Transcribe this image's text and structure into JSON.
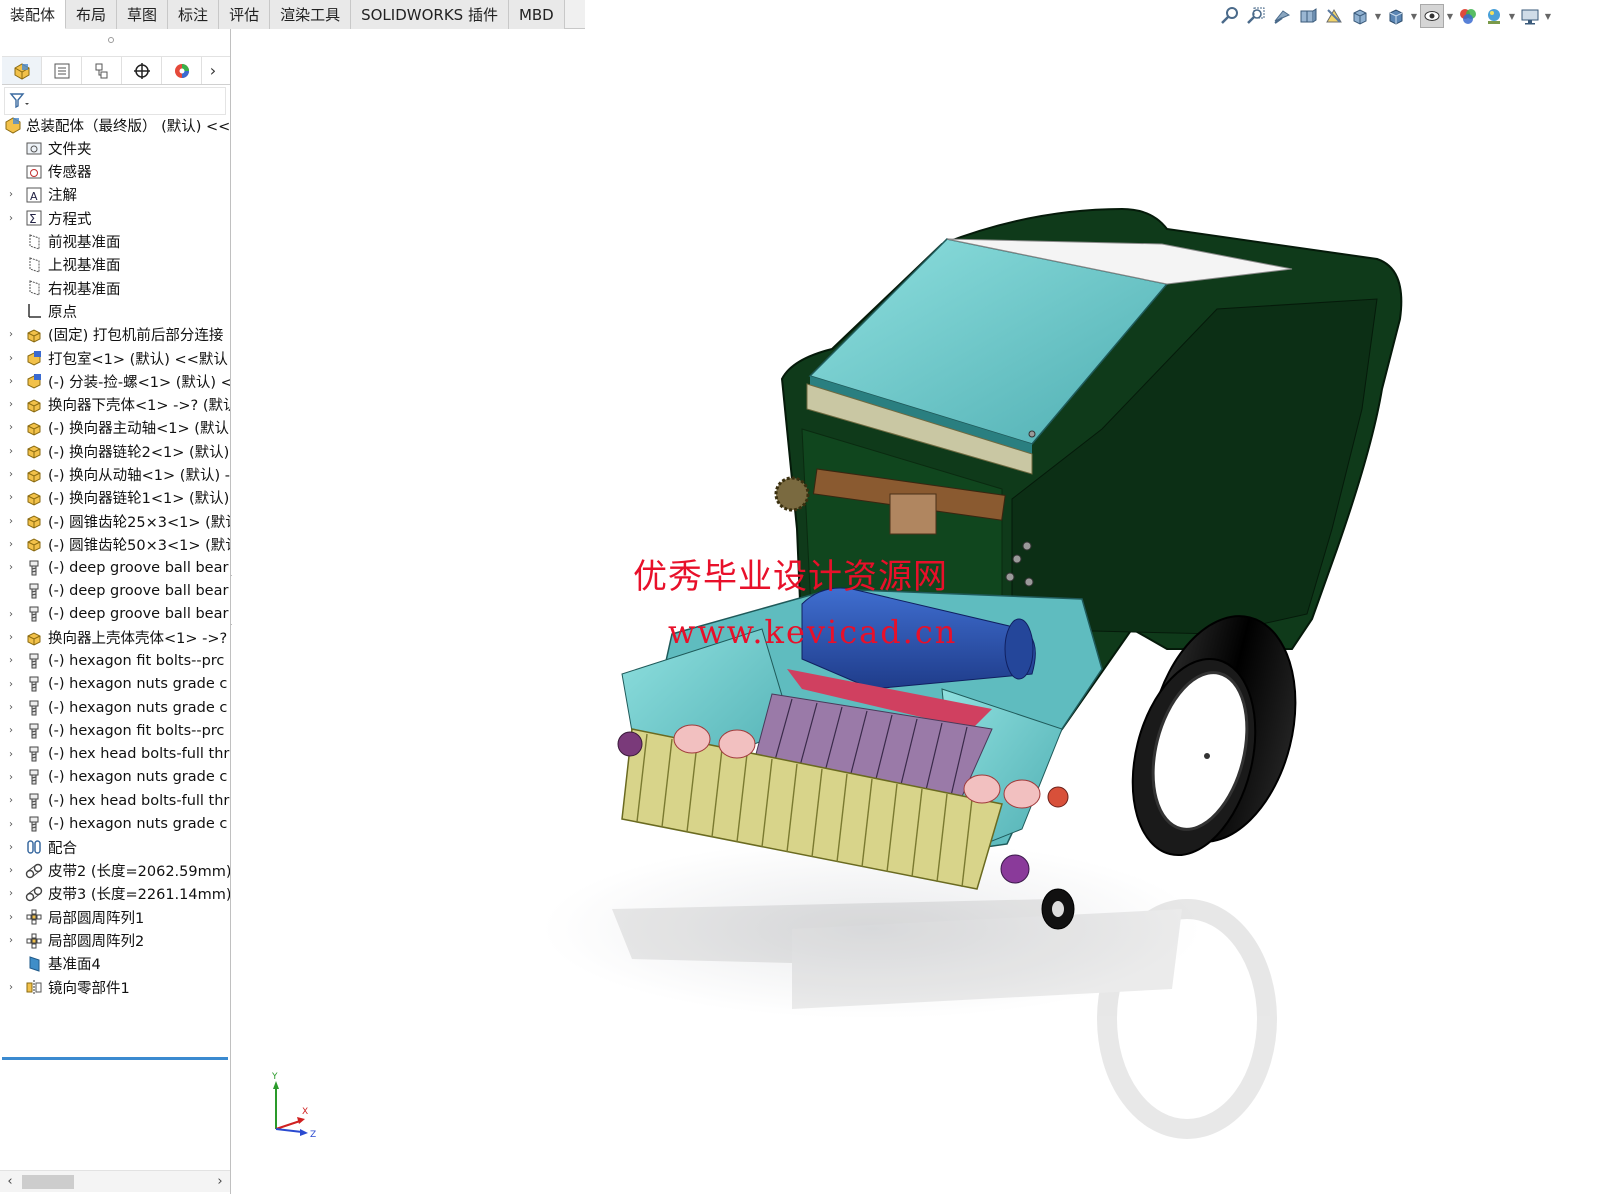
{
  "command_tabs": [
    "装配体",
    "布局",
    "草图",
    "标注",
    "评估",
    "渲染工具",
    "SOLIDWORKS 插件",
    "MBD"
  ],
  "heads_up_toolbar": [
    {
      "icon": "zoom-to-fit-icon"
    },
    {
      "icon": "zoom-to-area-icon"
    },
    {
      "icon": "previous-view-icon"
    },
    {
      "icon": "section-view-icon"
    },
    {
      "icon": "dynamic-annotation-icon"
    },
    {
      "icon": "view-orientation-icon"
    },
    {
      "icon": "display-style-icon"
    },
    {
      "icon": "hide-show-items-icon"
    },
    {
      "icon": "edit-appearance-icon"
    },
    {
      "icon": "apply-scene-icon"
    },
    {
      "icon": "view-settings-icon"
    }
  ],
  "panel_tabs": [
    {
      "icon": "feature-manager-icon"
    },
    {
      "icon": "property-manager-icon"
    },
    {
      "icon": "configuration-manager-icon"
    },
    {
      "icon": "dimxpert-manager-icon"
    },
    {
      "icon": "display-manager-icon"
    }
  ],
  "filter": {
    "icon": "filter-icon"
  },
  "tree": {
    "root": "总装配体（最终版） (默认) <<",
    "items": [
      {
        "label": "文件夹",
        "icon": "history-folder-icon",
        "expand": false
      },
      {
        "label": "传感器",
        "icon": "sensor-icon",
        "expand": false
      },
      {
        "label": "注解",
        "icon": "annotations-icon",
        "expand": true
      },
      {
        "label": "方程式",
        "icon": "equations-icon",
        "expand": true
      },
      {
        "label": "前视基准面",
        "icon": "plane-icon",
        "expand": false
      },
      {
        "label": "上视基准面",
        "icon": "plane-icon",
        "expand": false
      },
      {
        "label": "右视基准面",
        "icon": "plane-icon",
        "expand": false
      },
      {
        "label": "原点",
        "icon": "origin-icon",
        "expand": false
      },
      {
        "label": "(固定) 打包机前后部分连接",
        "icon": "subassembly-icon",
        "expand": true
      },
      {
        "label": "打包室<1> (默认) <<默认",
        "icon": "subassembly-edit-icon",
        "expand": true
      },
      {
        "label": "(-) 分装-捡-螺<1> (默认) <",
        "icon": "subassembly-edit-icon",
        "expand": true
      },
      {
        "label": "换向器下壳体<1> ->? (默认",
        "icon": "subassembly-icon",
        "expand": true
      },
      {
        "label": "(-) 换向器主动轴<1> (默认",
        "icon": "subassembly-icon",
        "expand": true
      },
      {
        "label": "(-) 换向器链轮2<1> (默认)",
        "icon": "subassembly-icon",
        "expand": true
      },
      {
        "label": "(-) 换向从动轴<1> (默认) -",
        "icon": "subassembly-icon",
        "expand": true
      },
      {
        "label": "(-) 换向器链轮1<1> (默认)",
        "icon": "subassembly-icon",
        "expand": true
      },
      {
        "label": "(-) 圆锥齿轮25×3<1> (默认",
        "icon": "subassembly-icon",
        "expand": true
      },
      {
        "label": "(-) 圆锥齿轮50×3<1> (默认",
        "icon": "subassembly-icon",
        "expand": true
      },
      {
        "label": "(-) deep groove ball bear",
        "icon": "toolbox-part-icon",
        "expand": true
      },
      {
        "label": "(-) deep groove ball bear",
        "icon": "toolbox-part-icon",
        "expand": false
      },
      {
        "label": "(-) deep groove ball bear",
        "icon": "toolbox-part-icon",
        "expand": true
      },
      {
        "label": "换向器上壳体壳体<1> ->?",
        "icon": "subassembly-icon",
        "expand": true
      },
      {
        "label": "(-) hexagon fit bolts--prc",
        "icon": "toolbox-part-icon",
        "expand": true
      },
      {
        "label": "(-) hexagon nuts grade c",
        "icon": "toolbox-part-icon",
        "expand": true
      },
      {
        "label": "(-) hexagon nuts grade c",
        "icon": "toolbox-part-icon",
        "expand": true
      },
      {
        "label": "(-) hexagon fit bolts--prc",
        "icon": "toolbox-part-icon",
        "expand": true
      },
      {
        "label": "(-) hex head bolts-full thr",
        "icon": "toolbox-part-icon",
        "expand": true
      },
      {
        "label": "(-) hexagon nuts grade c",
        "icon": "toolbox-part-icon",
        "expand": true
      },
      {
        "label": "(-) hex head bolts-full thr",
        "icon": "toolbox-part-icon",
        "expand": true
      },
      {
        "label": "(-) hexagon nuts grade c",
        "icon": "toolbox-part-icon",
        "expand": true
      },
      {
        "label": "配合",
        "icon": "mates-icon",
        "expand": true
      },
      {
        "label": "皮带2 (长度=2062.59mm)",
        "icon": "belt-chain-icon",
        "expand": true
      },
      {
        "label": "皮带3 (长度=2261.14mm)",
        "icon": "belt-chain-icon",
        "expand": true
      },
      {
        "label": "局部圆周阵列1",
        "icon": "circular-pattern-icon",
        "expand": true
      },
      {
        "label": "局部圆周阵列2",
        "icon": "circular-pattern-icon",
        "expand": true
      },
      {
        "label": "基准面4",
        "icon": "plane-solid-icon",
        "expand": false
      },
      {
        "label": "镜向零部件1",
        "icon": "mirror-components-icon",
        "expand": true
      }
    ]
  },
  "watermark": {
    "line1": "优秀毕业设计资源网",
    "line2": "www.kevicad.cn"
  },
  "triad": {
    "y": "Y",
    "x": "X",
    "z": "Z"
  },
  "colors": {
    "teal": "#6fc7c9",
    "dark_green": "#0f3a1a",
    "tire": "#111111",
    "blue_roller": "#2a4fb0",
    "watermark_red": "#e8102a"
  }
}
